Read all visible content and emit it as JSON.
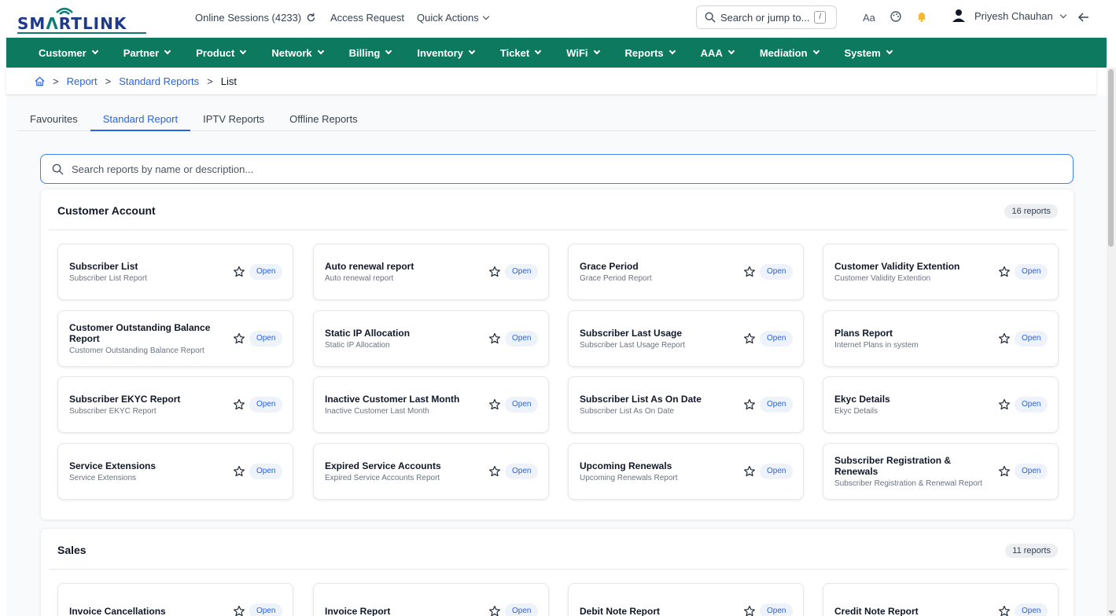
{
  "brand": {
    "logo_text_a": "SM",
    "logo_text_b": "RTLINK",
    "logo_mark": "Λ"
  },
  "header": {
    "online_sessions": "Online Sessions (4233)",
    "access_request": "Access Request",
    "quick_actions": "Quick Actions",
    "search_placeholder": "Search or jump to...",
    "search_shortcut": "/",
    "font_toggle": "Aa",
    "user_name": "Priyesh Chauhan"
  },
  "nav": [
    "Customer",
    "Partner",
    "Product",
    "Network",
    "Billing",
    "Inventory",
    "Ticket",
    "WiFi",
    "Reports",
    "AAA",
    "Mediation",
    "System"
  ],
  "breadcrumb": {
    "item1": "Report",
    "item2": "Standard Reports",
    "current": "List"
  },
  "tabs": [
    "Favourites",
    "Standard Report",
    "IPTV Reports",
    "Offline Reports"
  ],
  "active_tab": "Standard Report",
  "report_search": {
    "placeholder": "Search reports by name or description..."
  },
  "open_label": "Open",
  "sections": [
    {
      "title": "Customer Account",
      "count": "16 reports",
      "reports": [
        {
          "title": "Subscriber List",
          "desc": "Subscriber List Report"
        },
        {
          "title": "Auto renewal report",
          "desc": "Auto renewal report"
        },
        {
          "title": "Grace Period",
          "desc": "Grace Period Report"
        },
        {
          "title": "Customer Validity Extention",
          "desc": "Customer Validity Extention"
        },
        {
          "title": "Customer Outstanding Balance Report",
          "desc": "Customer Outstanding Balance Report"
        },
        {
          "title": "Static IP Allocation",
          "desc": "Static IP Allocation"
        },
        {
          "title": "Subscriber Last Usage",
          "desc": "Subscriber Last Usage Report"
        },
        {
          "title": "Plans Report",
          "desc": "Internet Plans in system"
        },
        {
          "title": "Subscriber EKYC Report",
          "desc": "Subscriber EKYC Report"
        },
        {
          "title": "Inactive Customer Last Month",
          "desc": "Inactive Customer Last Month"
        },
        {
          "title": "Subscriber List As On Date",
          "desc": "Subscriber List As On Date"
        },
        {
          "title": "Ekyc Details",
          "desc": "Ekyc Details"
        },
        {
          "title": "Service Extensions",
          "desc": "Service Extensions"
        },
        {
          "title": "Expired Service Accounts",
          "desc": "Expired Service Accounts Report"
        },
        {
          "title": "Upcoming Renewals",
          "desc": "Upcoming Renewals Report"
        },
        {
          "title": "Subscriber Registration & Renewals",
          "desc": "Subscriber Registration & Renewal Report"
        }
      ]
    },
    {
      "title": "Sales",
      "count": "11 reports",
      "reports": [
        {
          "title": "Invoice Cancellations",
          "desc": ""
        },
        {
          "title": "Invoice Report",
          "desc": ""
        },
        {
          "title": "Debit Note Report",
          "desc": ""
        },
        {
          "title": "Credit Note Report",
          "desc": ""
        }
      ]
    }
  ],
  "colors": {
    "brand_green": "#0d7a5f",
    "link_blue": "#2563eb",
    "notification": "#f5b82e"
  }
}
